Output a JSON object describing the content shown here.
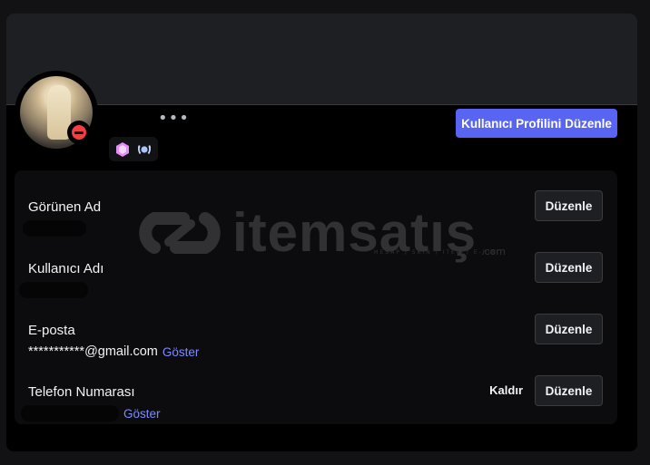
{
  "profile": {
    "more_label": "•••",
    "edit_profile_label": "Kullanıcı Profilini Düzenle",
    "badges": [
      "hypesquad-icon",
      "laurel-badge-icon"
    ]
  },
  "fields": [
    {
      "label": "Görünen Ad",
      "value": "",
      "reveal": "",
      "edit_label": "Düzenle"
    },
    {
      "label": "Kullanıcı Adı",
      "value": "",
      "reveal": "",
      "edit_label": "Düzenle"
    },
    {
      "label": "E-posta",
      "value": "***********@gmail.com",
      "reveal": "Göster",
      "edit_label": "Düzenle"
    },
    {
      "label": "Telefon Numarası",
      "value": "",
      "reveal": "Göster",
      "edit_label": "Düzenle",
      "remove_label": "Kaldır"
    }
  ],
  "watermark": {
    "text": "itemsatış",
    "sub": "HESAP / SKIN / ITEM / E-PIN",
    "com": ".com"
  },
  "colors": {
    "accent": "#5865f2",
    "dnd": "#f23f43",
    "link": "#7b8cff"
  }
}
